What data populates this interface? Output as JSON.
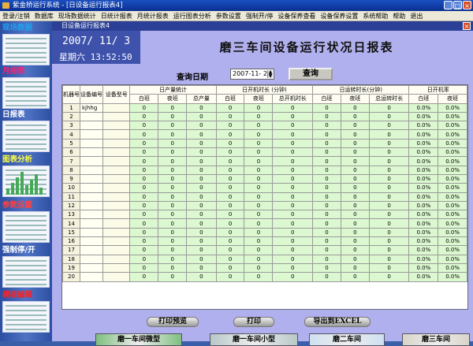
{
  "title": {
    "text": "紫金桥运行系统 - [日设备运行报表4]",
    "min": "_",
    "max": "□",
    "close": "×"
  },
  "menu": [
    "登录/注销",
    "数据库",
    "现场数据统计",
    "日统计报表",
    "月统计报表",
    "运行图表分析",
    "参数设置",
    "强制开/停",
    "设备保养查看",
    "设备保养设置",
    "系统帮助",
    "帮助",
    "退出"
  ],
  "sidebar": [
    {
      "label": "现场数据",
      "color": "#22a0f0"
    },
    {
      "label": "月报表",
      "color": "#ff2070"
    },
    {
      "label": "日报表",
      "color": "#ffffff"
    },
    {
      "label": "图表分析",
      "color": "#ffff40"
    },
    {
      "label": "参数设置",
      "color": "#ff4040"
    },
    {
      "label": "强制停/开",
      "color": "#ffffff"
    },
    {
      "label": "模板编辑",
      "color": "#ff2020"
    }
  ],
  "window": {
    "title": "日设备运行报表4",
    "close": "×"
  },
  "clock": {
    "date": "2007/ 11/  3",
    "time": "星期六 13:52:50"
  },
  "report": {
    "title": "磨三车间设备运行状况日报表"
  },
  "query": {
    "label": "查询日期",
    "date": "2007-11- 2",
    "button": "查询"
  },
  "table": {
    "headers": {
      "machine_no": "机器号",
      "device_no": "设备编号",
      "device_model": "设备型号",
      "group1": "日产量统计",
      "group2": "日开机时长 (分钟)",
      "group3": "日运转时长(分钟)",
      "group4": "日开机率",
      "day": "白班",
      "night": "夜班",
      "total_output": "总产量",
      "total_on": "总开机时长",
      "total_run": "总运转时长"
    },
    "rows": [
      {
        "n": "1",
        "code": "kjhhg",
        "v": [
          "0",
          "0",
          "0",
          "0",
          "0",
          "0",
          "0",
          "0",
          "0",
          "0.0%",
          "0.0%"
        ]
      },
      {
        "n": "2",
        "code": "",
        "v": [
          "0",
          "0",
          "0",
          "0",
          "0",
          "0",
          "0",
          "0",
          "0",
          "0.0%",
          "0.0%"
        ]
      },
      {
        "n": "3",
        "code": "",
        "v": [
          "0",
          "0",
          "0",
          "0",
          "0",
          "0",
          "0",
          "0",
          "0",
          "0.0%",
          "0.0%"
        ]
      },
      {
        "n": "4",
        "code": "",
        "v": [
          "0",
          "0",
          "0",
          "0",
          "0",
          "0",
          "0",
          "0",
          "0",
          "0.0%",
          "0.0%"
        ]
      },
      {
        "n": "5",
        "code": "",
        "v": [
          "0",
          "0",
          "0",
          "0",
          "0",
          "0",
          "0",
          "0",
          "0",
          "0.0%",
          "0.0%"
        ]
      },
      {
        "n": "6",
        "code": "",
        "v": [
          "0",
          "0",
          "0",
          "0",
          "0",
          "0",
          "0",
          "0",
          "0",
          "0.0%",
          "0.0%"
        ]
      },
      {
        "n": "7",
        "code": "",
        "v": [
          "0",
          "0",
          "0",
          "0",
          "0",
          "0",
          "0",
          "0",
          "0",
          "0.0%",
          "0.0%"
        ]
      },
      {
        "n": "8",
        "code": "",
        "v": [
          "0",
          "0",
          "0",
          "0",
          "0",
          "0",
          "0",
          "0",
          "0",
          "0.0%",
          "0.0%"
        ]
      },
      {
        "n": "9",
        "code": "",
        "v": [
          "0",
          "0",
          "0",
          "0",
          "0",
          "0",
          "0",
          "0",
          "0",
          "0.0%",
          "0.0%"
        ]
      },
      {
        "n": "10",
        "code": "",
        "v": [
          "0",
          "0",
          "0",
          "0",
          "0",
          "0",
          "0",
          "0",
          "0",
          "0.0%",
          "0.0%"
        ]
      },
      {
        "n": "11",
        "code": "",
        "v": [
          "0",
          "0",
          "0",
          "0",
          "0",
          "0",
          "0",
          "0",
          "0",
          "0.0%",
          "0.0%"
        ]
      },
      {
        "n": "12",
        "code": "",
        "v": [
          "0",
          "0",
          "0",
          "0",
          "0",
          "0",
          "0",
          "0",
          "0",
          "0.0%",
          "0.0%"
        ]
      },
      {
        "n": "13",
        "code": "",
        "v": [
          "0",
          "0",
          "0",
          "0",
          "0",
          "0",
          "0",
          "0",
          "0",
          "0.0%",
          "0.0%"
        ]
      },
      {
        "n": "14",
        "code": "",
        "v": [
          "0",
          "0",
          "0",
          "0",
          "0",
          "0",
          "0",
          "0",
          "0",
          "0.0%",
          "0.0%"
        ]
      },
      {
        "n": "15",
        "code": "",
        "v": [
          "0",
          "0",
          "0",
          "0",
          "0",
          "0",
          "0",
          "0",
          "0",
          "0.0%",
          "0.0%"
        ]
      },
      {
        "n": "16",
        "code": "",
        "v": [
          "0",
          "0",
          "0",
          "0",
          "0",
          "0",
          "0",
          "0",
          "0",
          "0.0%",
          "0.0%"
        ]
      },
      {
        "n": "17",
        "code": "",
        "v": [
          "0",
          "0",
          "0",
          "0",
          "0",
          "0",
          "0",
          "0",
          "0",
          "0.0%",
          "0.0%"
        ]
      },
      {
        "n": "18",
        "code": "",
        "v": [
          "0",
          "0",
          "0",
          "0",
          "0",
          "0",
          "0",
          "0",
          "0",
          "0.0%",
          "0.0%"
        ]
      },
      {
        "n": "19",
        "code": "",
        "v": [
          "0",
          "0",
          "0",
          "0",
          "0",
          "0",
          "0",
          "0",
          "0",
          "0.0%",
          "0.0%"
        ]
      },
      {
        "n": "20",
        "code": "",
        "v": [
          "0",
          "0",
          "0",
          "0",
          "0",
          "0",
          "0",
          "0",
          "0",
          "0.0%",
          "0.0%"
        ]
      }
    ]
  },
  "actions": {
    "preview": "打印预览",
    "print": "打印",
    "export": "导出到EXCEL"
  },
  "workshops": [
    {
      "label": "磨一车间微型",
      "bg": "#7fbf7f"
    },
    {
      "label": "磨一车间小型",
      "bg": "#b8c8c8"
    },
    {
      "label": "磨二车间",
      "bg": "#cfe0f0"
    },
    {
      "label": "磨三车间",
      "bg": "#d8d4c8"
    }
  ]
}
